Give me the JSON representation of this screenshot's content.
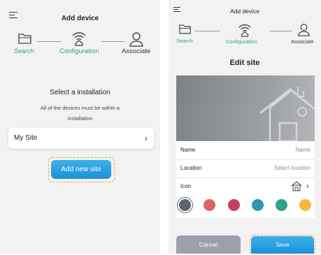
{
  "left": {
    "title": "Add device",
    "steps": [
      {
        "label": "Search",
        "icon": "folder-icon"
      },
      {
        "label": "Configuration",
        "icon": "router-wifi-icon"
      },
      {
        "label": "Associate",
        "icon": "user-icon"
      }
    ],
    "heading": "Select a installation",
    "subtext_line1": "All of the devices must be within a",
    "subtext_line2": "installation",
    "site_name": "My Site",
    "add_button": "Add new site"
  },
  "right": {
    "title": "Add device",
    "steps": [
      {
        "label": "Search",
        "icon": "folder-icon"
      },
      {
        "label": "Configuration",
        "icon": "router-wifi-icon"
      },
      {
        "label": "Associate",
        "icon": "user-icon"
      }
    ],
    "heading": "Edit site",
    "fields": {
      "name_label": "Name",
      "name_placeholder": "Name",
      "location_label": "Location",
      "location_placeholder": "Select location",
      "icon_label": "Icon"
    },
    "colors": [
      "#5d646e",
      "#e06363",
      "#c4405a",
      "#2f98b4",
      "#2da28a",
      "#fbb73d"
    ],
    "cancel": "Cancel",
    "save": "Save"
  },
  "theme": {
    "accent_blue": "#1e9ee0",
    "active_step": "#2aa77a",
    "dashed_highlight": "#f3a626"
  }
}
